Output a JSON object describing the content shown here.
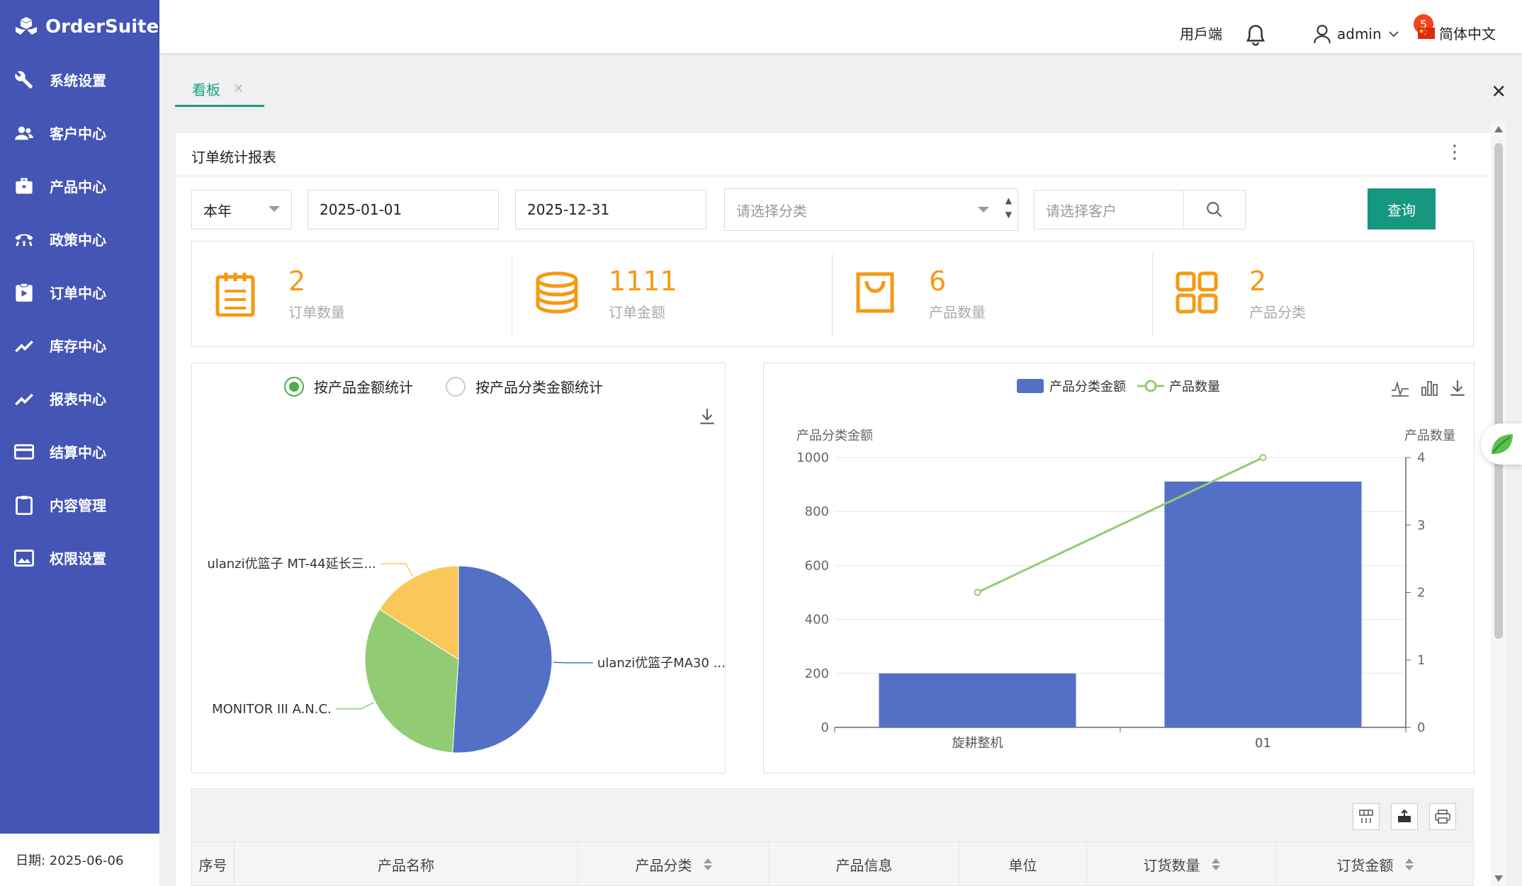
{
  "app": {
    "name": "OrderSuite"
  },
  "sidebar": {
    "items": [
      {
        "label": "系统设置",
        "icon": "wrench-icon"
      },
      {
        "label": "客户中心",
        "icon": "users-icon"
      },
      {
        "label": "产品中心",
        "icon": "briefcase-icon"
      },
      {
        "label": "政策中心",
        "icon": "phone-icon"
      },
      {
        "label": "订单中心",
        "icon": "clipboard-icon"
      },
      {
        "label": "库存中心",
        "icon": "trend-icon"
      },
      {
        "label": "报表中心",
        "icon": "trend-icon"
      },
      {
        "label": "结算中心",
        "icon": "credit-card-icon"
      },
      {
        "label": "内容管理",
        "icon": "clipboard-outline-icon"
      },
      {
        "label": "权限设置",
        "icon": "image-icon"
      }
    ],
    "footer_date": "日期: 2025-06-06"
  },
  "header": {
    "user_portal": "用戶端",
    "notification_count": "5",
    "user": "admin",
    "language": "简体中文"
  },
  "tabs": [
    {
      "label": "看板"
    }
  ],
  "report": {
    "title": "订单统计报表",
    "filters": {
      "period": "本年",
      "start_date": "2025-01-01",
      "end_date": "2025-12-31",
      "category_placeholder": "请选择分类",
      "customer_placeholder": "请选择客户",
      "query_label": "查询"
    },
    "stats": [
      {
        "value": "2",
        "label": "订单数量",
        "icon": "notepad-icon"
      },
      {
        "value": "1111",
        "label": "订单金额",
        "icon": "coins-icon"
      },
      {
        "value": "6",
        "label": "产品数量",
        "icon": "bag-icon"
      },
      {
        "value": "2",
        "label": "产品分类",
        "icon": "grid-icon"
      }
    ],
    "pie_options": [
      "按产品金额统计",
      "按产品分类金额统计"
    ],
    "pie_selected": 0
  },
  "table": {
    "columns": [
      "序号",
      "产品名称",
      "产品分类",
      "产品信息",
      "单位",
      "订货数量",
      "订货金额"
    ]
  },
  "colors": {
    "sidebar": "#4455b5",
    "accent": "#16977f",
    "stat": "#f59a12"
  },
  "chart_data": [
    {
      "type": "pie",
      "labels": [
        "ulanzi优篮子MA30 ...",
        "MONITOR III A.N.C.",
        "ulanzi优篮子 MT-44延长三..."
      ],
      "values": [
        51,
        33,
        16
      ],
      "colors": [
        "#5470c6",
        "#91cc75",
        "#fac858"
      ]
    },
    {
      "type": "bar",
      "categories": [
        "旋耕整机",
        "01"
      ],
      "series": [
        {
          "name": "产品分类金额",
          "type": "bar",
          "values": [
            200,
            911
          ],
          "color": "#5470c6"
        },
        {
          "name": "产品数量",
          "type": "line",
          "values": [
            2,
            4
          ],
          "color": "#91cc75"
        }
      ],
      "ylabel": "产品分类金额",
      "y2label": "产品数量",
      "ylim": [
        0,
        1000
      ],
      "y2lim": [
        0,
        4
      ],
      "yticks": [
        "0",
        "200",
        "400",
        "600",
        "800",
        "1000"
      ],
      "y2ticks": [
        "0",
        "1",
        "2",
        "3",
        "4"
      ],
      "legend": "top"
    }
  ]
}
